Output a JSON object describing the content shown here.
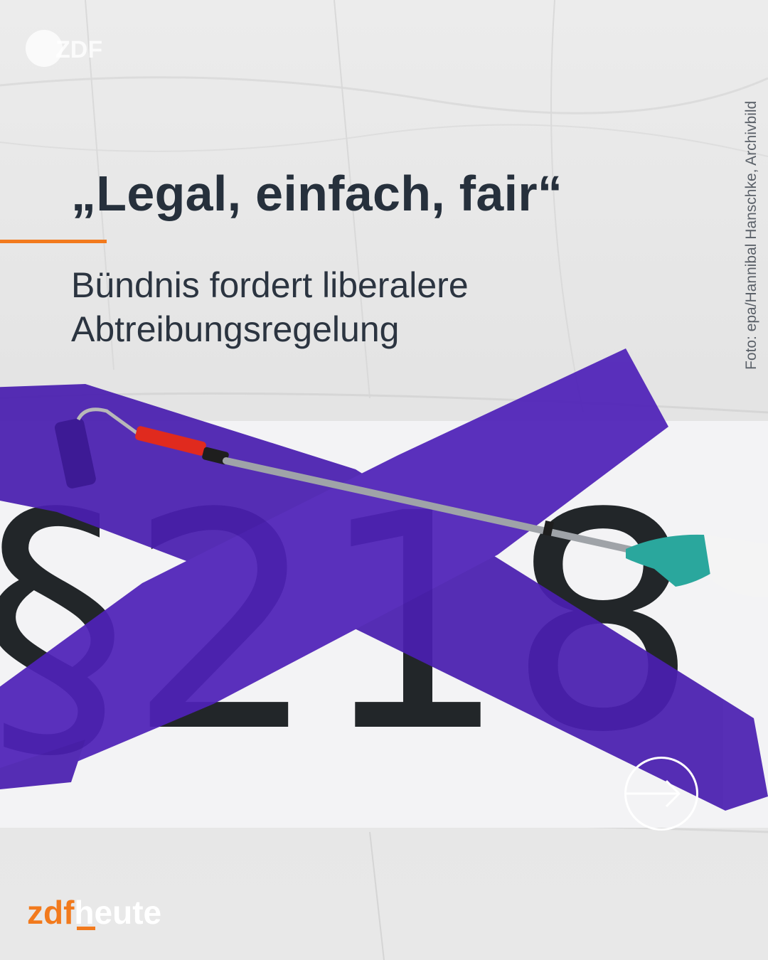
{
  "post": {
    "headline": "„Legal, einfach, fair“",
    "subheadline": "Bündnis fordert liberalere Abtreibungsregelung",
    "photo_credit": "Foto: epa/Hannibal Hanschke, Archivbild"
  },
  "poster": {
    "text": "§218"
  },
  "watermark": {
    "logo": "ZDF"
  },
  "brand": {
    "part1": "zdf",
    "part2": "heute"
  },
  "navigation": {
    "next_icon": "arrow-right-circle-icon"
  },
  "colors": {
    "accent_orange": "#f27a1d",
    "headline_text": "#26303c",
    "paint_purple": "#4a1fb0",
    "background": "#e9e9e9"
  }
}
